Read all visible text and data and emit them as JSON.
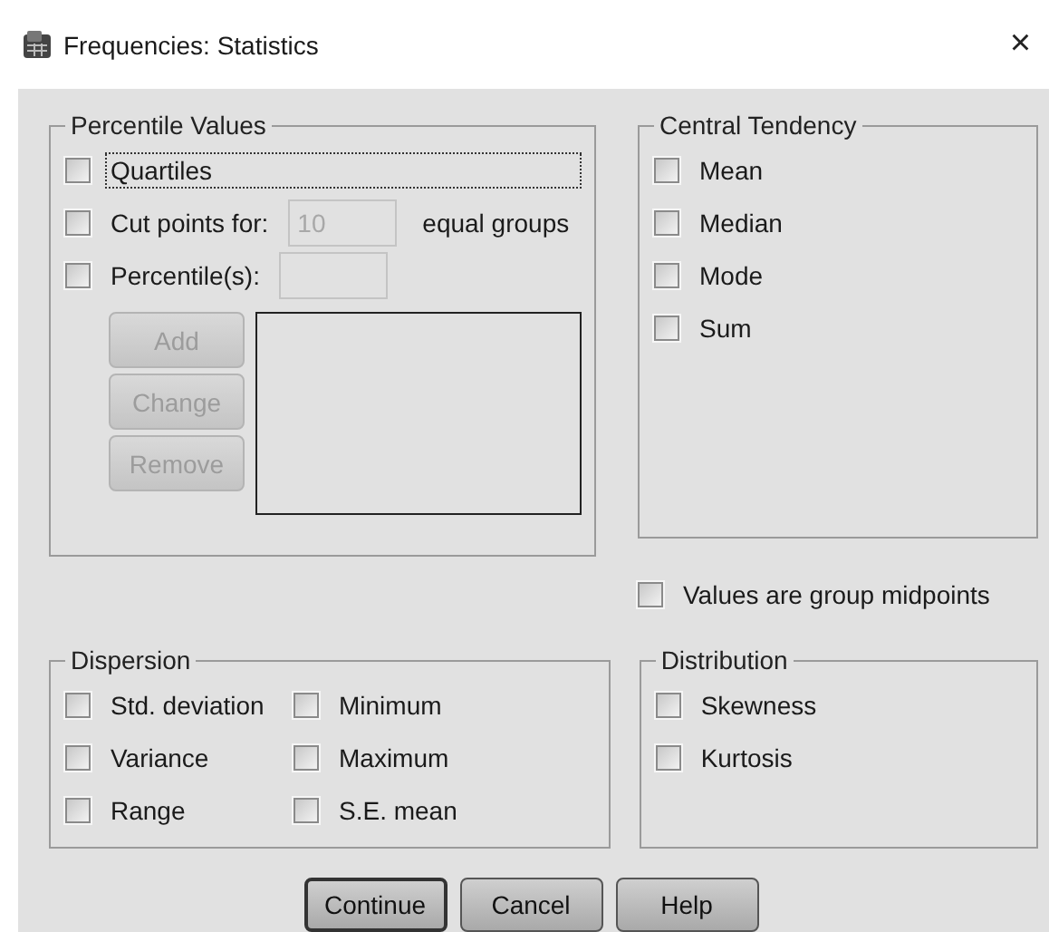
{
  "window": {
    "title": "Frequencies: Statistics",
    "close": "×"
  },
  "percentile_values": {
    "title": "Percentile Values",
    "quartiles": {
      "label": "Quartiles",
      "checked": false,
      "focused": true
    },
    "cut_points": {
      "label": "Cut points for:",
      "checked": false,
      "value": "10",
      "disabled": true,
      "suffix": "equal groups"
    },
    "percentiles": {
      "label": "Percentile(s):",
      "checked": false,
      "disabled": true
    },
    "buttons": [
      {
        "label": "Add",
        "disabled": true
      },
      {
        "label": "Change",
        "disabled": true
      },
      {
        "label": "Remove",
        "disabled": true
      }
    ]
  },
  "central_tendency": {
    "title": "Central Tendency",
    "items": [
      {
        "label": "Mean",
        "checked": false
      },
      {
        "label": "Median",
        "checked": false
      },
      {
        "label": "Mode",
        "checked": false
      },
      {
        "label": "Sum",
        "checked": false
      }
    ]
  },
  "group_midpoints": {
    "label": "Values are group midpoints",
    "checked": false
  },
  "dispersion": {
    "title": "Dispersion",
    "items": [
      {
        "label": "Std. deviation",
        "checked": false
      },
      {
        "label": "Minimum",
        "checked": false
      },
      {
        "label": "Variance",
        "checked": false
      },
      {
        "label": "Maximum",
        "checked": false
      },
      {
        "label": "Range",
        "checked": false
      },
      {
        "label": "S.E. mean",
        "checked": false
      }
    ]
  },
  "distribution": {
    "title": "Distribution",
    "items": [
      {
        "label": "Skewness",
        "checked": false
      },
      {
        "label": "Kurtosis",
        "checked": false
      }
    ]
  },
  "buttons": [
    {
      "label": "Continue",
      "default": true
    },
    {
      "label": "Cancel",
      "default": false
    },
    {
      "label": "Help",
      "default": false
    }
  ]
}
